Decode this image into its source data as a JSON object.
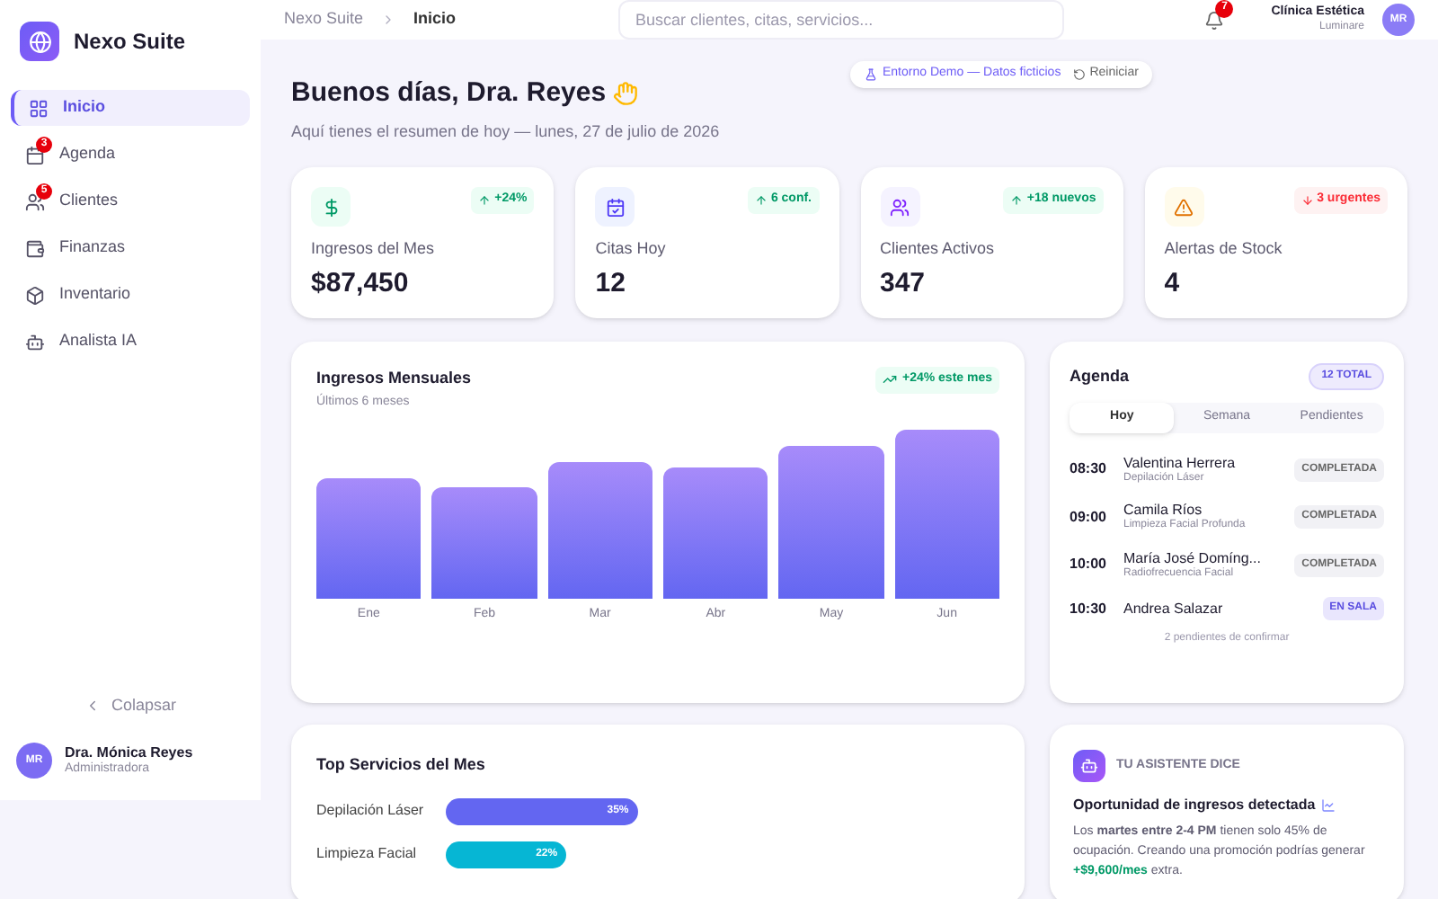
{
  "sidebar": {
    "brand": "Nexo Suite",
    "items": [
      {
        "label": "Inicio",
        "selected": true,
        "kind": "grid"
      },
      {
        "label": "Agenda",
        "selected": false,
        "kind": "calendar",
        "badge": "3"
      },
      {
        "label": "Clientes",
        "selected": false,
        "kind": "users",
        "badge": "5"
      },
      {
        "label": "Finanzas",
        "selected": false,
        "kind": "wallet"
      },
      {
        "label": "Inventario",
        "selected": false,
        "kind": "box"
      },
      {
        "label": "Analista IA",
        "selected": false,
        "kind": "bot"
      }
    ],
    "collapse_label": "Colapsar",
    "user": {
      "initials": "MR",
      "name": "Dra. Mónica Reyes",
      "role": "Administradora"
    }
  },
  "header": {
    "breadcrumb": [
      "Nexo Suite",
      "Inicio"
    ],
    "search": {
      "placeholder": "Buscar clientes, citas, servicios..."
    },
    "notifications": "7",
    "org": {
      "name": "Clínica Estética",
      "subtitle": "Luminare",
      "initials": "MR"
    }
  },
  "demo_banner": {
    "label": "Entorno Demo — Datos ficticios",
    "action": "Reiniciar"
  },
  "greeting": {
    "title": "Buenos días, Dra. Reyes",
    "subtitle": "Aquí tienes el resumen de hoy — lunes, 27 de julio de 2026"
  },
  "stats": [
    {
      "kind": "revenue",
      "label": "Ingresos del Mes",
      "value": "$87,450",
      "change": "+24%",
      "rising": true
    },
    {
      "kind": "appointments",
      "label": "Citas Hoy",
      "value": "12",
      "change": "6 conf.",
      "rising": true
    },
    {
      "kind": "clients",
      "label": "Clientes Activos",
      "value": "347",
      "change": "+18 nuevos",
      "rising": true
    },
    {
      "kind": "alerts",
      "label": "Alertas de Stock",
      "value": "4",
      "change": "3 urgentes",
      "rising": false
    }
  ],
  "revenue_chart": {
    "title": "Ingresos Mensuales",
    "subtitle": "Últimos 6 meses",
    "badge": "+24% este mes",
    "month_labels": [
      "Ene",
      "Feb",
      "Mar",
      "Abr",
      "May",
      "Jun"
    ]
  },
  "agenda": {
    "title": "Agenda",
    "total": "12 TOTAL",
    "tabs": [
      {
        "label": "Hoy",
        "selected": true
      },
      {
        "label": "Semana",
        "selected": false
      },
      {
        "label": "Pendientes",
        "selected": false
      }
    ],
    "appointments": [
      {
        "time": "08:30",
        "name": "Valentina Herrera",
        "service": "Depilación Láser",
        "status": "COMPLETADA",
        "kind": "completed"
      },
      {
        "time": "09:00",
        "name": "Camila Ríos",
        "service": "Limpieza Facial Profunda",
        "status": "COMPLETADA",
        "kind": "completed"
      },
      {
        "time": "10:00",
        "name": "María José Domíng...",
        "service": "Radiofrecuencia Facial",
        "status": "COMPLETADA",
        "kind": "completed"
      },
      {
        "time": "10:30",
        "name": "Andrea Salazar",
        "status": "EN SALA",
        "kind": "in_room"
      }
    ],
    "footer": "2 pendientes de confirmar"
  },
  "top_services": {
    "title": "Top Servicios del Mes",
    "items": [
      {
        "label": "Depilación Láser",
        "value": "35%",
        "level": 0.35,
        "color": "#6366f1"
      },
      {
        "label": "Limpieza Facial",
        "value": "22%",
        "level": 0.22,
        "color": "#06b6d4"
      }
    ]
  },
  "assistant": {
    "label": "TU ASISTENTE DICE",
    "title": "Oportunidad de ingresos detectada",
    "body": "Los **martes entre 2-4 PM** tienen solo 45% de ocupación. Creando una promoción podrías generar",
    "highlight": "+$9,600/mes",
    "tail": "extra."
  }
}
